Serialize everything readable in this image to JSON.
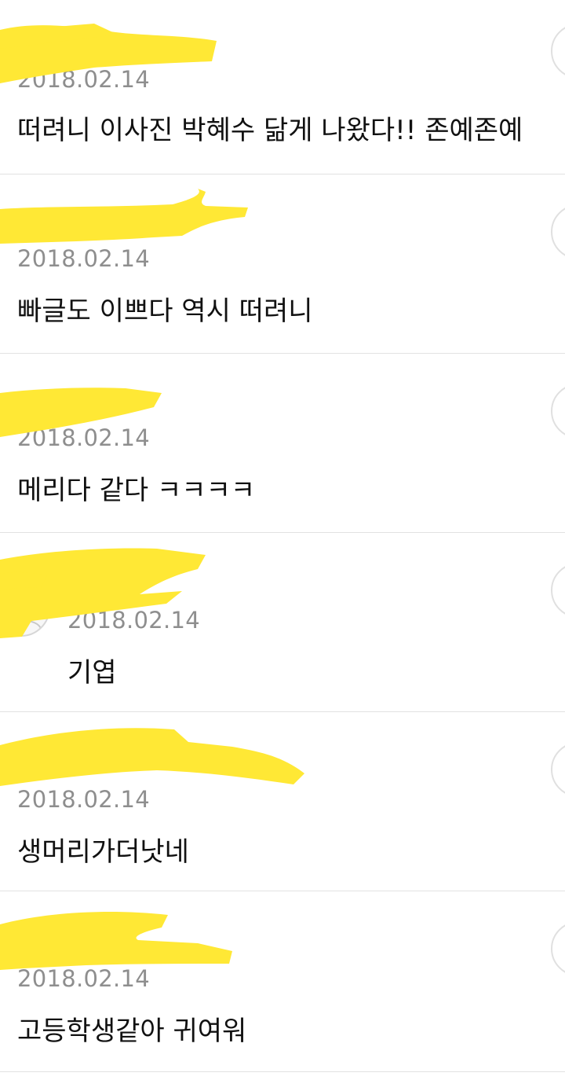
{
  "comments": [
    {
      "author": "",
      "date": "2018.02.14",
      "text": "떠려니 이사진 박혜수 닮게 나왔다!! 존예존예"
    },
    {
      "author": "",
      "date": "2018.02.14",
      "text": "빠글도 이쁘다 역시 떠려니"
    },
    {
      "author": "",
      "date": "2018.02.14",
      "text": "메리다 같다 ㅋㅋㅋㅋ"
    },
    {
      "author": "",
      "date": "2018.02.14",
      "text": "기엽"
    },
    {
      "author": "",
      "date": "2018.02.14",
      "text": "생머리가더낫네"
    },
    {
      "author": "",
      "date": "2018.02.14",
      "text": "고등학생같아 귀여워"
    }
  ],
  "colors": {
    "highlight": "#FFE835",
    "date": "#8E8E8E",
    "text": "#111111",
    "divider": "#E2E2E2"
  },
  "icons": {
    "more": "circle-more-icon",
    "avatar": "default-avatar-icon"
  }
}
